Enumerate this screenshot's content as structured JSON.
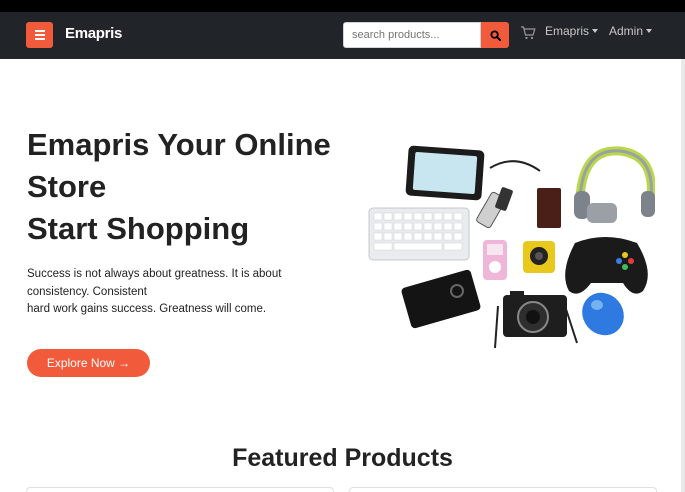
{
  "navbar": {
    "brand": "Emapris",
    "search_placeholder": "search products...",
    "links": [
      {
        "label": "Emapris",
        "has_dropdown": true
      },
      {
        "label": "Admin",
        "has_dropdown": true
      }
    ],
    "accent_color": "#f15a3b",
    "bar_color": "#212529"
  },
  "hero": {
    "title_lines": [
      "Emapris Your Online",
      "Store",
      "Start Shopping"
    ],
    "text_lines": [
      "Success is not always about greatness. It is about",
      "consistency. Consistent",
      "hard work gains success. Greatness will come."
    ],
    "cta_label": "Explore Now →"
  },
  "featured": {
    "title": "Featured Products"
  }
}
